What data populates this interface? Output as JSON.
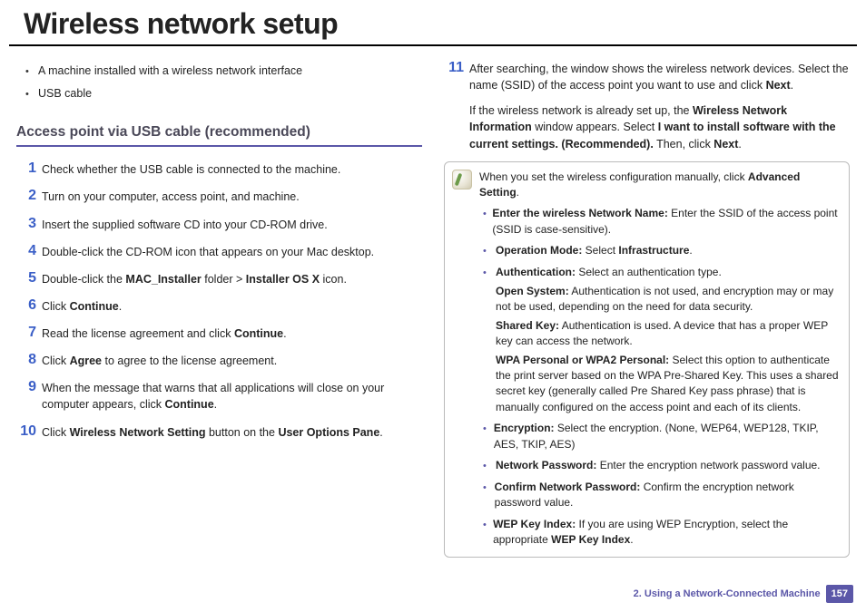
{
  "title": "Wireless network setup",
  "pre_bullets": [
    "A machine installed with a wireless network interface",
    "USB cable"
  ],
  "section_heading": "Access point via USB cable (recommended)",
  "steps": [
    "Check whether the USB cable is connected to the machine.",
    "Turn on your computer, access point, and machine.",
    "Insert the supplied software CD into your CD-ROM drive.",
    "Double-click the CD-ROM icon that appears on your Mac desktop.",
    "Double-click the <b>MAC_Installer</b> folder &gt; <b>Installer OS X</b> icon.",
    "Click <b>Continue</b>.",
    "Read the license agreement and click <b>Continue</b>.",
    "Click <b>Agree</b> to agree to the license agreement.",
    "When the message that warns that all applications will close on your computer appears, click <b>Continue</b>.",
    "Click <b>Wireless Network Setting</b> button on the <b>User Options Pane</b>.",
    "After searching, the window shows the wireless network devices. Select the name (SSID) of the access point you want to use and click <b>Next</b>."
  ],
  "step11_extra": "If the wireless network is already set up, the <b>Wireless Network Information</b> window appears. Select <b>I want to install software with the current settings. (Recommended).</b> Then, click <b>Next</b>.",
  "note_intro": "When you set the wireless configuration manually, click <b>Advanced Setting</b>.",
  "note_items": [
    {
      "lead": "<b>Enter the wireless Network Name:</b> Enter the SSID of the access point (SSID is case-sensitive)."
    },
    {
      "lead": "<b>Operation Mode:</b> Select <b>Infrastructure</b>."
    },
    {
      "lead": "<b>Authentication:</b> Select an authentication type.",
      "subs": [
        "<b>Open System:</b> Authentication is not used, and encryption may or may not be used, depending on the need for data security.",
        "<b>Shared Key:</b> Authentication is used. A device that has a proper WEP key can access the network.",
        "<b>WPA Personal or WPA2 Personal:</b> Select this option to authenticate the print server based on the WPA Pre-Shared Key. This uses a shared secret key (generally called Pre Shared Key pass phrase) that is manually configured on the access point and each of its clients."
      ]
    },
    {
      "lead": "<b>Encryption:</b> Select the encryption. (None, WEP64, WEP128, TKIP, AES, TKIP, AES)"
    },
    {
      "lead": "<b>Network Password:</b> Enter the encryption network password value."
    },
    {
      "lead": "<b>Confirm Network Password:</b> Confirm the encryption network password value."
    },
    {
      "lead": "<b>WEP Key Index:</b> If you are using WEP Encryption, select the appropriate <b>WEP Key Index</b>."
    }
  ],
  "footer_chapter": "2.  Using a Network-Connected Machine",
  "footer_page": "157"
}
